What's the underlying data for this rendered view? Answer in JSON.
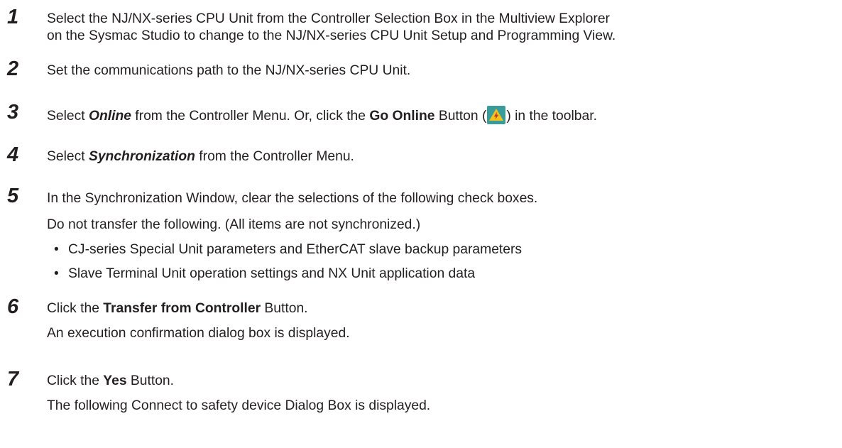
{
  "steps": [
    {
      "number": "1",
      "lines": [
        "Select the NJ/NX-series CPU Unit from the Controller Selection Box in the Multiview Explorer",
        "on the Sysmac Studio to change to the NJ/NX-series CPU Unit Setup and Programming View."
      ]
    },
    {
      "number": "2",
      "lines": [
        "Set the communications path to the NJ/NX-series CPU Unit."
      ]
    },
    {
      "number": "3",
      "text_a": "Select ",
      "menu_item": "Online",
      "text_b": " from the Controller Menu. Or, click the ",
      "button_name": "Go Online",
      "text_c": " Button (",
      "icon": "go-online-icon",
      "text_d": ") in the toolbar."
    },
    {
      "number": "4",
      "text_a": "Select ",
      "menu_item": "Synchronization",
      "text_b": " from the Controller Menu."
    },
    {
      "number": "5",
      "lines": [
        "In the Synchronization Window, clear the selections of the following check boxes.",
        "Do not transfer the following. (All items are not synchronized.)"
      ],
      "bullet": "•",
      "bullets": [
        "CJ-series Special Unit parameters and EtherCAT slave backup parameters",
        "Slave Terminal Unit operation settings and NX Unit application data"
      ]
    },
    {
      "number": "6",
      "text_a": "Click the ",
      "button_name": "Transfer from Controller",
      "text_b": " Button.",
      "result": "An execution confirmation dialog box is displayed."
    },
    {
      "number": "7",
      "text_a": "Click the ",
      "button_name": "Yes",
      "text_b": " Button.",
      "result": "The following Connect to safety device Dialog Box is displayed."
    }
  ],
  "colors": {
    "text": "#231f20",
    "icon_bg": "#3a9c9a",
    "icon_symbol": "#f2c21b"
  }
}
